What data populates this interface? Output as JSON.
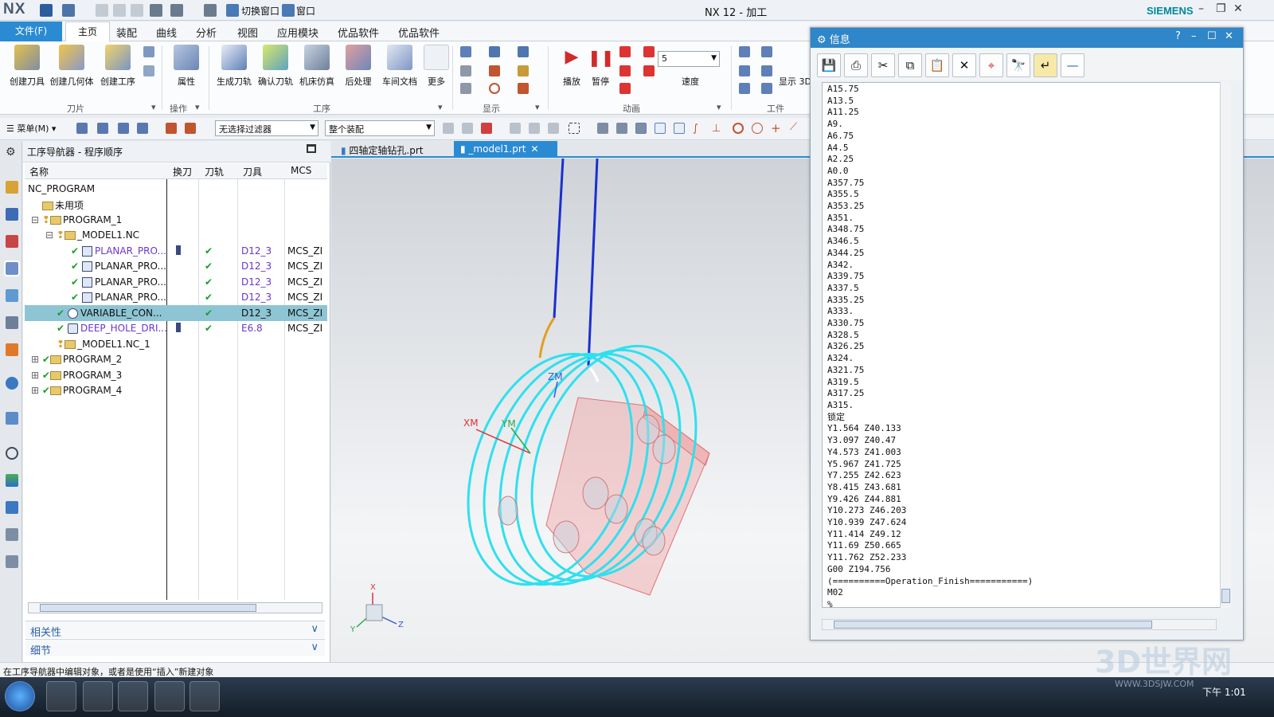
{
  "app": {
    "logo": "NX",
    "title": "NX 12 - 加工",
    "brand": "SIEMENS",
    "switch_window": "切换窗口",
    "window_menu": "窗口"
  },
  "tabs": [
    "文件(F)",
    "主页",
    "装配",
    "曲线",
    "分析",
    "视图",
    "应用模块",
    "优品软件",
    "优品软件"
  ],
  "ribbon": {
    "tool_group": {
      "buttons": [
        "创建刀具",
        "创建几何体",
        "创建工序"
      ],
      "label": "刀片"
    },
    "ops_group": {
      "buttons": [
        "属性"
      ],
      "label": "操作"
    },
    "work_group": {
      "buttons": [
        "生成刀轨",
        "确认刀轨",
        "机床仿真",
        "后处理",
        "车间文档",
        "更多"
      ],
      "label": "工序"
    },
    "display_group": {
      "label": "显示"
    },
    "anim_group": {
      "buttons": [
        "播放",
        "暂停"
      ],
      "speed_label": "速度",
      "speed_value": "5",
      "label": "动画"
    },
    "part_group": {
      "buttons": [
        "显示 3D"
      ],
      "label": "工件"
    }
  },
  "toolbar2": {
    "menu": "菜单(M)",
    "filter": "无选择过滤器",
    "scope": "整个装配"
  },
  "navigator": {
    "title": "工序导航器 - 程序顺序",
    "columns": [
      "名称",
      "换刀",
      "刀轨",
      "刀具",
      "MCS"
    ],
    "rows": [
      {
        "name": "NC_PROGRAM",
        "tool": "",
        "mcs": ""
      },
      {
        "name": "未用项",
        "tool": "",
        "mcs": ""
      },
      {
        "name": "PROGRAM_1",
        "tool": "",
        "mcs": ""
      },
      {
        "name": "_MODEL1.NC",
        "tool": "",
        "mcs": ""
      },
      {
        "name": "PLANAR_PRO...",
        "tool": "D12_3",
        "mcs": "MCS_ZI"
      },
      {
        "name": "PLANAR_PRO...",
        "tool": "D12_3",
        "mcs": "MCS_ZI"
      },
      {
        "name": "PLANAR_PRO...",
        "tool": "D12_3",
        "mcs": "MCS_ZI"
      },
      {
        "name": "PLANAR_PRO...",
        "tool": "D12_3",
        "mcs": "MCS_ZI"
      },
      {
        "name": "VARIABLE_CON...",
        "tool": "D12_3",
        "mcs": "MCS_ZI"
      },
      {
        "name": "DEEP_HOLE_DRI...",
        "tool": "E6.8",
        "mcs": "MCS_ZI"
      },
      {
        "name": "_MODEL1.NC_1",
        "tool": "",
        "mcs": ""
      },
      {
        "name": "PROGRAM_2",
        "tool": "",
        "mcs": ""
      },
      {
        "name": "PROGRAM_3",
        "tool": "",
        "mcs": ""
      },
      {
        "name": "PROGRAM_4",
        "tool": "",
        "mcs": ""
      }
    ],
    "panels": [
      "相关性",
      "细节"
    ]
  },
  "viewport": {
    "tabs": [
      "四轴定轴钻孔.prt",
      "_model1.prt"
    ],
    "axes": {
      "xm": "XM",
      "ym": "YM",
      "zm": "ZM",
      "x": "X",
      "y": "Y",
      "z": "Z"
    }
  },
  "info": {
    "title": "信息",
    "lines": [
      "A15.75",
      "A13.5",
      "A11.25",
      "A9.",
      "A6.75",
      "A4.5",
      "A2.25",
      "A0.0",
      "A357.75",
      "A355.5",
      "A353.25",
      "A351.",
      "A348.75",
      "A346.5",
      "A344.25",
      "A342.",
      "A339.75",
      "A337.5",
      "A335.25",
      "A333.",
      "A330.75",
      "A328.5",
      "A326.25",
      "A324.",
      "A321.75",
      "A319.5",
      "A317.25",
      "A315.",
      "锁定",
      "Y1.564 Z40.133",
      "Y3.097 Z40.47",
      "Y4.573 Z41.003",
      "Y5.967 Z41.725",
      "Y7.255 Z42.623",
      "Y8.415 Z43.681",
      "Y9.426 Z44.881",
      "Y10.273 Z46.203",
      "Y10.939 Z47.624",
      "Y11.414 Z49.12",
      "Y11.69 Z50.665",
      "Y11.762 Z52.233",
      "G00 Z194.756",
      "(==========Operation_Finish===========)",
      "M02",
      "%"
    ]
  },
  "status": "在工序导航器中编辑对象，或者是使用“插入”新建对象",
  "taskbar": {
    "clock": "下午 1:01"
  },
  "watermark": {
    "text": "3D世界网",
    "sub": "WWW.3DSJW.COM"
  }
}
